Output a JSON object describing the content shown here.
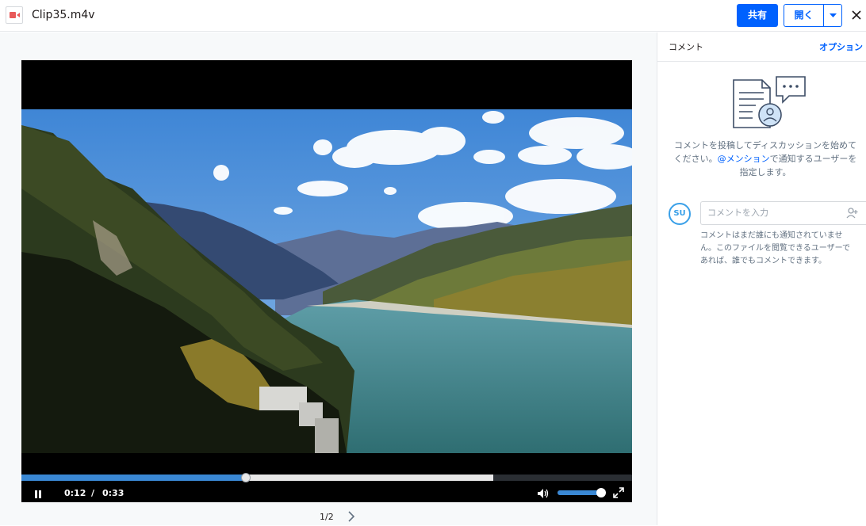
{
  "header": {
    "file_name": "Clip35.m4v",
    "file_icon": "video-file-icon",
    "share_label": "共有",
    "open_label": "開く",
    "open_caret_icon": "chevron-down-icon",
    "close_icon": "close-icon",
    "accent_color": "#0061fe"
  },
  "player": {
    "current_time": "0:12",
    "separator": "/",
    "duration": "0:33",
    "played_fraction": 0.367,
    "buffered_fraction": 0.773,
    "volume_fraction": 0.98,
    "pause_icon": "pause-icon",
    "volume_icon": "speaker-icon",
    "fullscreen_icon": "fullscreen-icon"
  },
  "pager": {
    "label": "1/2",
    "next_icon": "chevron-right-icon"
  },
  "comments": {
    "title": "コメント",
    "options_label": "オプション",
    "empty_line1": "コメントを投稿してディスカッションを始めて",
    "empty_line2_pre": "ください。",
    "empty_mention": "@メンション",
    "empty_line2_post": "で通知するユーザーを",
    "empty_line3": "指定します。",
    "avatar_initials": "SU",
    "input_placeholder": "コメントを入力",
    "add_user_icon": "add-user-icon",
    "note_line1": "コメントはまだ誰にも通知されていませ",
    "note_line2": "ん。このファイルを閲覧できるユーザーで",
    "note_line3": "あれば、誰でもコメントできます。"
  }
}
